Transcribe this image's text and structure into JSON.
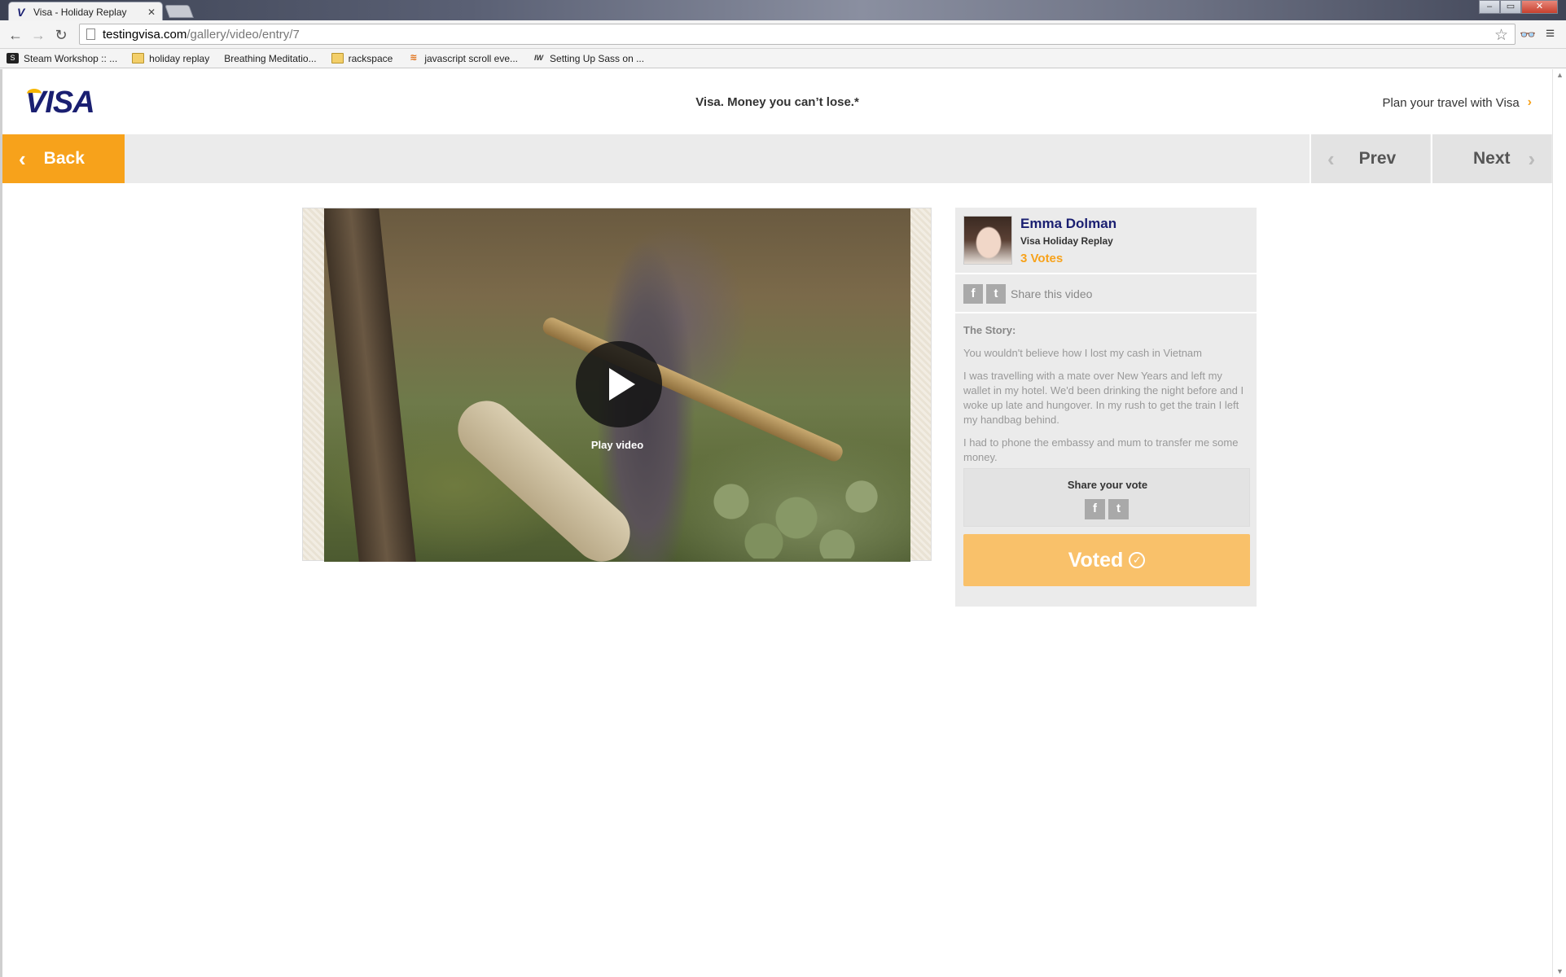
{
  "browser": {
    "tab_title": "Visa - Holiday Replay",
    "tab_icon": "visa-favicon",
    "url_host": "testingvisa.com",
    "url_path": "/gallery/video/entry/7",
    "bookmarks": [
      {
        "label": "Steam Workshop :: ...",
        "icon": "steam-icon"
      },
      {
        "label": "holiday replay",
        "icon": "folder-icon"
      },
      {
        "label": "Breathing Meditatio...",
        "icon": "none"
      },
      {
        "label": "rackspace",
        "icon": "folder-icon"
      },
      {
        "label": "javascript scroll eve...",
        "icon": "stackoverflow-icon"
      },
      {
        "label": "Setting Up Sass on ...",
        "icon": "iw-icon"
      }
    ]
  },
  "header": {
    "logo": "VISA",
    "tagline": "Visa. Money you can’t lose.*",
    "plan_link": "Plan your travel with Visa",
    "plan_arrow": "›"
  },
  "nav": {
    "back": "Back",
    "prev": "Prev",
    "next": "Next",
    "back_chevron": "‹",
    "prev_chevron": "‹",
    "next_chevron": "›"
  },
  "video": {
    "play_label": "Play video"
  },
  "entry": {
    "name": "Emma Dolman",
    "subtitle": "Visa Holiday Replay",
    "votes": "3 Votes",
    "share_video": "Share this video",
    "story_title": "The Story:",
    "story_paragraphs": [
      "You wouldn't believe how I lost my cash in Vietnam",
      "I was travelling with a mate over New Years and left my wallet in my hotel. We'd been drinking the night before and I woke up late and hungover. In my rush to get the train I left my handbag behind.",
      "I had to phone the embassy and mum to transfer me some money."
    ],
    "share_vote_title": "Share your vote",
    "voted_label": "Voted",
    "voted_check": "✓"
  },
  "colors": {
    "visa_blue": "#1a1f71",
    "visa_orange": "#f7a21b",
    "voted_bg": "#f9c16a"
  }
}
